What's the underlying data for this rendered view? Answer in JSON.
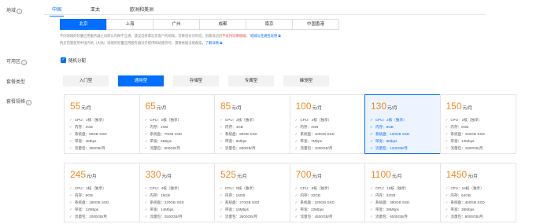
{
  "labels": {
    "region": "地域",
    "zone": "可用区",
    "package_type": "套餐类型",
    "package_spec": "套餐规格"
  },
  "region_tabs": [
    "中国",
    "亚太",
    "欧洲和美洲"
  ],
  "cities": [
    "北京",
    "上海",
    "广州",
    "成都",
    "南京",
    "中国香港"
  ],
  "notes": {
    "line1_a": "不同地域的轻量应用服务器之间默认内网不互通，建议选择靠近您客户的地域，可降低访问时延；创建成功后",
    "line1_red": "不支持切换地域",
    "line1_sep": "。",
    "line1_link": "地域与连通性说明",
    "line2_a": "购买后需使用中国内地（大陆）地域的轻量应用服务器对外提供网站服务时，需要依据法规备案。",
    "line2_link": "了解详情"
  },
  "zone": {
    "checkbox_label": "随机分配",
    "checked": true
  },
  "package_types": [
    "入门型",
    "通用型",
    "存储型",
    "专属型",
    "蜂驰型"
  ],
  "active_type_index": 1,
  "price_unit": "元/月",
  "plans": [
    {
      "price": "55",
      "cpu": "CPU：2核（独享）",
      "mem": "内存：2GB",
      "disk": "系统盘：60GB SSD",
      "bw": "带宽：4Mbps",
      "traffic": "流量包：300GB/月",
      "selected": false
    },
    {
      "price": "65",
      "cpu": "CPU：2核（独享）",
      "mem": "内存：2GB",
      "disk": "系统盘：70GB SSD",
      "bw": "带宽：5Mbps",
      "traffic": "流量包：500GB/月",
      "selected": false
    },
    {
      "price": "85",
      "cpu": "CPU：2核（独享）",
      "mem": "内存：4GB",
      "disk": "系统盘：80GB SSD",
      "bw": "带宽：6Mbps",
      "traffic": "流量包：800GB/月",
      "selected": false
    },
    {
      "price": "100",
      "cpu": "CPU：2核（独享）",
      "mem": "内存：4GB",
      "disk": "系统盘：100GB SSD",
      "bw": "带宽：7Mbps",
      "traffic": "流量包：1000GB/月",
      "selected": false
    },
    {
      "price": "130",
      "cpu": "CPU：2核（独享）",
      "mem": "内存：8GB",
      "disk": "系统盘：120GB SSD",
      "bw": "带宽：8Mbps",
      "traffic": "流量包：1200GB/月",
      "selected": true
    },
    {
      "price": "150",
      "cpu": "CPU：2核（独享）",
      "mem": "内存：8GB",
      "disk": "系统盘：150GB SSD",
      "bw": "带宽：10Mbps",
      "traffic": "流量包：1500GB/月",
      "selected": false
    },
    {
      "price": "245",
      "cpu": "CPU：4核（独享）",
      "mem": "内存：8GB",
      "disk": "系统盘：180GB SSD",
      "bw": "带宽：12Mbps",
      "traffic": "流量包：2000GB/月",
      "selected": false
    },
    {
      "price": "330",
      "cpu": "CPU：4核（独享）",
      "mem": "内存：16GB",
      "disk": "系统盘：220GB SSD",
      "bw": "带宽：14Mbps",
      "traffic": "流量包：2500GB/月",
      "selected": false
    },
    {
      "price": "525",
      "cpu": "CPU：8核（独享）",
      "mem": "内存：16GB",
      "disk": "系统盘：270GB SSD",
      "bw": "带宽：18Mbps",
      "traffic": "流量包：3500GB/月",
      "selected": false
    },
    {
      "price": "700",
      "cpu": "CPU：8核（独享）",
      "mem": "内存：32GB",
      "disk": "系统盘：320GB SSD",
      "bw": "带宽：22Mbps",
      "traffic": "流量包：4500GB/月",
      "selected": false
    },
    {
      "price": "1100",
      "cpu": "CPU：16核（独享）",
      "mem": "内存：32GB",
      "disk": "系统盘：380GB SSD",
      "bw": "带宽：28Mbps",
      "traffic": "流量包：6000GB/月",
      "selected": false
    },
    {
      "price": "1450",
      "cpu": "CPU：16核（独享）",
      "mem": "内存：64GB",
      "disk": "系统盘：450GB SSD",
      "bw": "带宽：35Mbps",
      "traffic": "流量包：8000GB/月",
      "selected": false
    }
  ],
  "colors": {
    "accent": "#006eff",
    "price": "#f08a24",
    "warning": "#e54545"
  }
}
